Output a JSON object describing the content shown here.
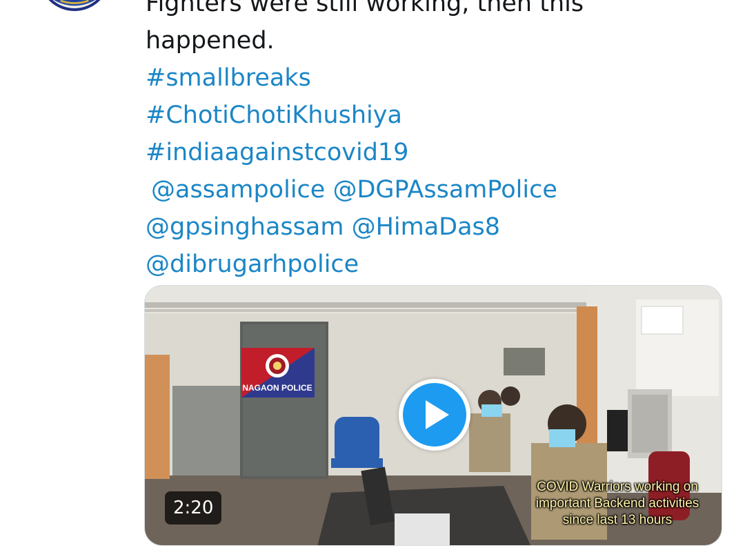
{
  "tweet": {
    "text_lines": [
      "Fighters were still working,  then this",
      "happened."
    ],
    "hashtags": [
      "#smallbreaks",
      "#ChotiChotiKhushiya",
      "#indiaagainstcovid19"
    ],
    "mentions_line1": [
      "@assampolice",
      "@DGPAssamPolice"
    ],
    "mentions_line2": [
      "@gpsinghassam",
      "@HimaDas8"
    ],
    "mentions_line3": [
      "@dibrugarhpolice"
    ]
  },
  "video": {
    "duration": "2:20",
    "sign_text": "NAGAON POLICE",
    "caption_lines": [
      "COVID Warriors working on",
      "important Backend activities",
      "since last 13  hours"
    ]
  },
  "colors": {
    "link": "#1b86c6",
    "text": "#14171a",
    "play_button": "#1d9bf0"
  },
  "icons": {
    "avatar": "assam-police-emblem-icon",
    "play": "play-icon"
  }
}
